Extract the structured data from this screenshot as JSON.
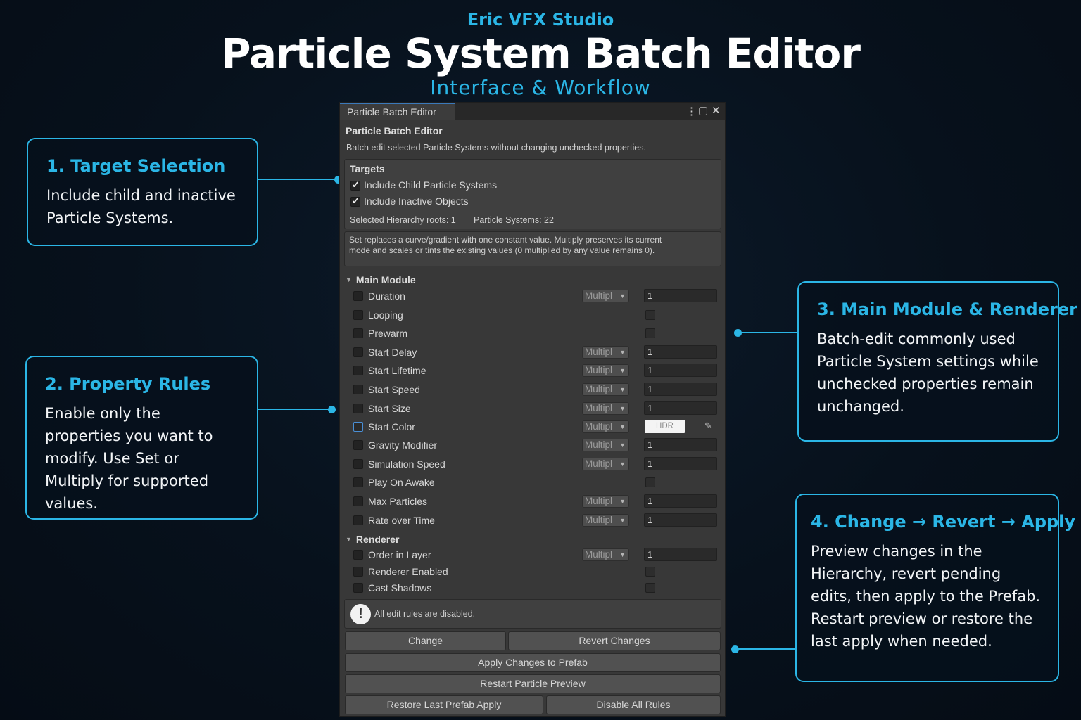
{
  "header": {
    "studio": "Eric VFX Studio",
    "title": "Particle System Batch Editor",
    "subtitle": "Interface & Workflow"
  },
  "callouts": [
    {
      "title": "1. Target Selection",
      "body": "Include child and inactive Particle Systems."
    },
    {
      "title": "2. Property Rules",
      "body": "Enable only the properties you want to modify. Use Set or Multiply for supported values."
    },
    {
      "title": "3. Main Module & Renderer",
      "body": "Batch-edit commonly used Particle System settings while unchecked properties remain unchanged."
    },
    {
      "title": "4. Change → Revert → Apply",
      "body": "Preview changes in the Hierarchy, revert pending edits, then apply to the Prefab. Restart preview or restore the last apply when needed."
    }
  ],
  "editor": {
    "tab_label": "Particle Batch Editor",
    "title": "Particle Batch Editor",
    "description": "Batch edit selected Particle Systems without changing unchecked properties.",
    "targets": {
      "title": "Targets",
      "include_children": "Include Child Particle Systems",
      "include_inactive": "Include Inactive Objects",
      "roots": "Selected Hierarchy roots: 1",
      "systems": "Particle Systems: 22"
    },
    "help_text": "Set replaces a curve/gradient with one constant value.  Multiply preserves its current mode and scales or tints the existing values (0 multiplied by any value remains 0).",
    "main_module": {
      "title": "Main Module",
      "rows": [
        {
          "label": "Duration",
          "mode": "Multipl",
          "value": "1"
        },
        {
          "label": "Looping",
          "mode": "",
          "value": ""
        },
        {
          "label": "Prewarm",
          "mode": "",
          "value": ""
        },
        {
          "label": "Start Delay",
          "mode": "Multipl",
          "value": "1"
        },
        {
          "label": "Start Lifetime",
          "mode": "Multipl",
          "value": "1"
        },
        {
          "label": "Start Speed",
          "mode": "Multipl",
          "value": "1"
        },
        {
          "label": "Start Size",
          "mode": "Multipl",
          "value": "1"
        },
        {
          "label": "Start Color",
          "mode": "Multipl",
          "value": "HDR"
        },
        {
          "label": "Gravity Modifier",
          "mode": "Multipl",
          "value": "1"
        },
        {
          "label": "Simulation Speed",
          "mode": "Multipl",
          "value": "1"
        },
        {
          "label": "Play On Awake",
          "mode": "",
          "value": ""
        },
        {
          "label": "Max Particles",
          "mode": "Multipl",
          "value": "1"
        },
        {
          "label": "Rate over Time",
          "mode": "Multipl",
          "value": "1"
        }
      ]
    },
    "renderer": {
      "title": "Renderer",
      "rows": [
        {
          "label": "Order in Layer",
          "mode": "Multipl",
          "value": "1"
        },
        {
          "label": "Renderer Enabled",
          "mode": "",
          "value": ""
        },
        {
          "label": "Cast Shadows",
          "mode": "",
          "value": ""
        }
      ]
    },
    "info": "All edit rules are disabled.",
    "buttons": {
      "change": "Change",
      "revert": "Revert Changes",
      "apply": "Apply Changes to Prefab",
      "restart": "Restart Particle Preview",
      "restore": "Restore Last Prefab Apply",
      "disable": "Disable All Rules"
    }
  },
  "colors": {
    "accent": "#2bb6e6",
    "background": "#07111c",
    "panel": "#383838"
  }
}
